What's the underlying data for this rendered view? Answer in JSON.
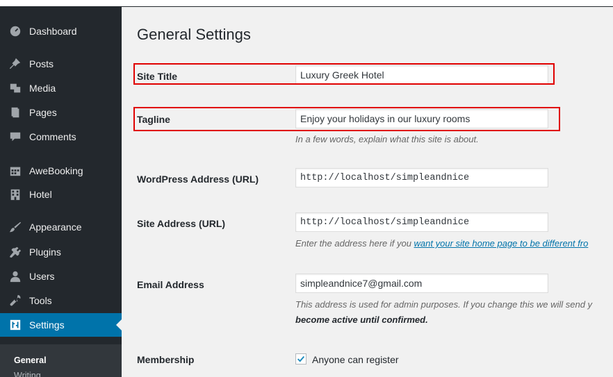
{
  "sidebar": {
    "items": [
      {
        "label": "Dashboard",
        "icon": "dashboard-icon"
      },
      {
        "label": "Posts",
        "icon": "pin-icon"
      },
      {
        "label": "Media",
        "icon": "media-icon"
      },
      {
        "label": "Pages",
        "icon": "pages-icon"
      },
      {
        "label": "Comments",
        "icon": "comment-icon"
      },
      {
        "label": "AweBooking",
        "icon": "calendar-icon"
      },
      {
        "label": "Hotel",
        "icon": "building-icon"
      },
      {
        "label": "Appearance",
        "icon": "brush-icon"
      },
      {
        "label": "Plugins",
        "icon": "plugin-icon"
      },
      {
        "label": "Users",
        "icon": "user-icon"
      },
      {
        "label": "Tools",
        "icon": "wrench-icon"
      },
      {
        "label": "Settings",
        "icon": "settings-icon"
      }
    ],
    "submenu": [
      "General",
      "Writing"
    ]
  },
  "main": {
    "title": "General Settings",
    "site_title": {
      "label": "Site Title",
      "value": "Luxury Greek Hotel"
    },
    "tagline": {
      "label": "Tagline",
      "value": "Enjoy your holidays in our luxury rooms",
      "description": "In a few words, explain what this site is about."
    },
    "wp_address": {
      "label": "WordPress Address (URL)",
      "value": "http://localhost/simpleandnice"
    },
    "site_address": {
      "label": "Site Address (URL)",
      "value": "http://localhost/simpleandnice",
      "description_prefix": "Enter the address here if you ",
      "description_link": "want your site home page to be different fro"
    },
    "email": {
      "label": "Email Address",
      "value": "simpleandnice7@gmail.com",
      "description_line1": "This address is used for admin purposes. If you change this we will send y",
      "description_line2": "become active until confirmed."
    },
    "membership": {
      "label": "Membership",
      "checkbox_label": "Anyone can register",
      "checked": true
    }
  },
  "colors": {
    "sidebar_bg": "#23282d",
    "active_bg": "#0073aa",
    "highlight": "#e00000",
    "link": "#0073aa"
  }
}
